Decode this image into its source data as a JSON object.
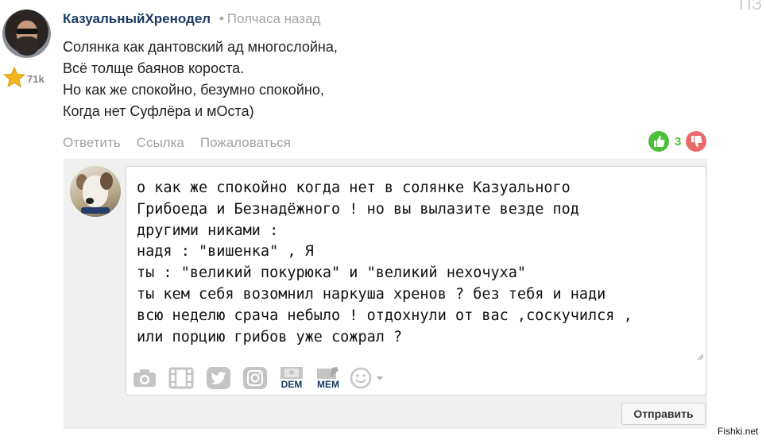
{
  "comment": {
    "author": "КазуальныйХренодел",
    "time": "Полчаса назад",
    "rating": "71k",
    "text": "Солянка как дантовский ад многослойна,\nВсё толще баянов короста.\nНо как же спокойно, безумно спокойно,\nКогда нет Суфлёра и мОста)",
    "actions": [
      "Ответить",
      "Ссылка",
      "Пожаловаться"
    ],
    "votes": "3"
  },
  "corner_text": "ПЗ",
  "reply": {
    "text": "о как же спокойно когда нет в солянке Казуального\nГрибоеда и Безнадёжного ! но вы вылазите везде под\nдругими никами :\nнадя : \"вишенка\" , Я\nты : \"великий покурюка\" и \"великий нехочуха\"\nты кем себя возомнил наркуша хренов ? без тебя и нади\nвсю неделю срача небыло ! отдохнули от вас ,соскучился ,\nили порцию грибов уже сожрал ?",
    "toolbar": {
      "dem_label": "DEM",
      "mem_label": "MEM",
      "icons": [
        "camera-icon",
        "video-icon",
        "twitter-icon",
        "instagram-icon",
        "demotivator-icon",
        "meme-icon",
        "smiley-icon",
        "dropdown-arrow-icon"
      ]
    },
    "send_label": "Отправить"
  },
  "watermark": "Fishki.net",
  "colors": {
    "author": "#1a3a63",
    "muted": "#a3a3a3",
    "vote_up": "#4cbf3a",
    "vote_down": "#ea6a6a",
    "panel": "#f0f0f0"
  }
}
